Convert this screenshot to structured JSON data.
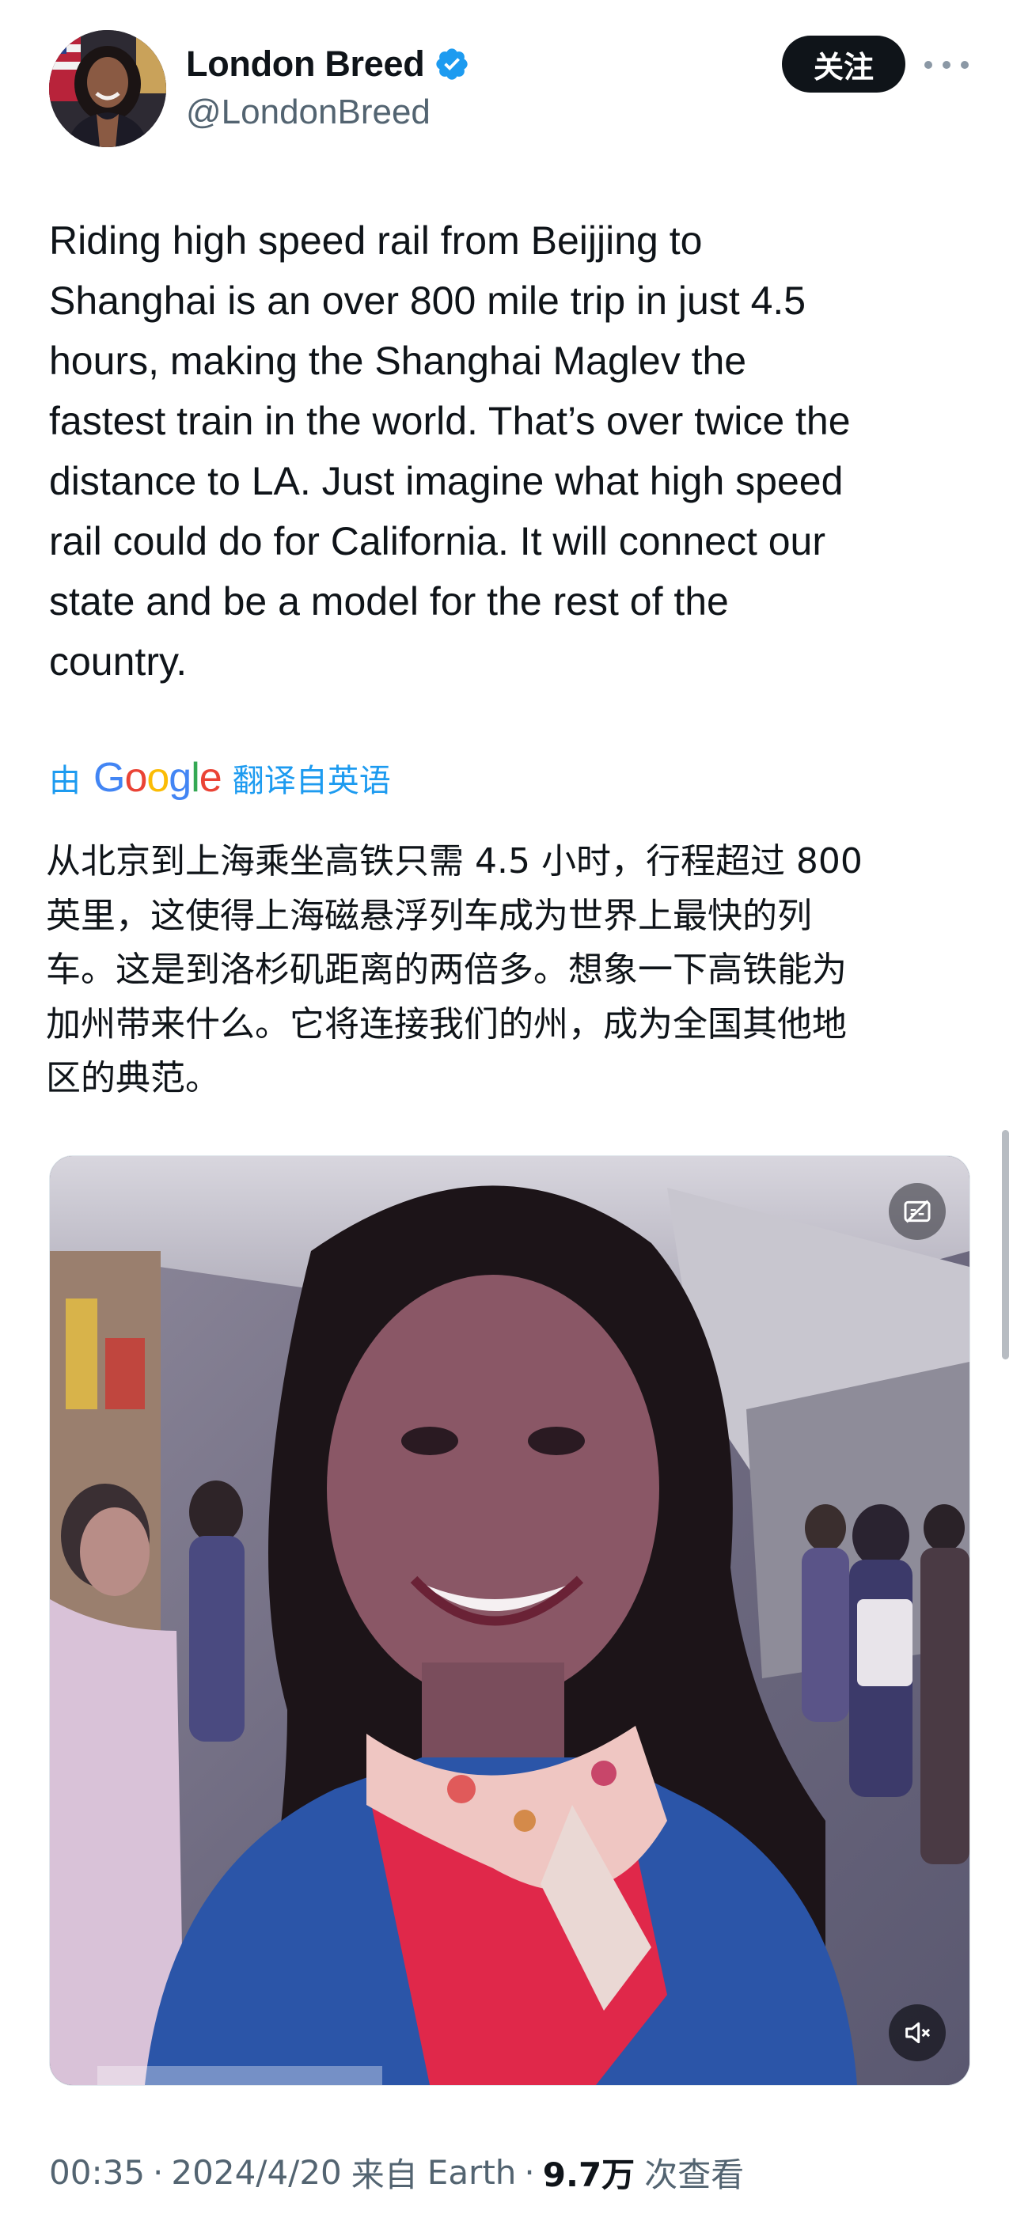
{
  "author": {
    "display_name": "London Breed",
    "handle": "@LondonBreed",
    "verified": true
  },
  "actions": {
    "follow_label": "关注"
  },
  "tweet": {
    "text": "Riding high speed rail from Beijjing to\nShanghai is an over 800 mile trip in just 4.5\nhours, making the Shanghai Maglev the\nfastest train in the world. That’s over twice the\ndistance to LA. Just imagine what high speed\nrail could do for California. It will connect our\nstate and be a model for the rest of the\ncountry."
  },
  "translation": {
    "prefix": "由",
    "provider": "Google",
    "suffix": "翻译自英语",
    "text": "从北京到上海乘坐高铁只需 4.5 小时，行程超过 800\n英里，这使得上海磁悬浮列车成为世界上最快的列\n车。这是到洛杉矶距离的两倍多。想象一下高铁能为\n加州带来什么。它将连接我们的州，成为全国其他地\n区的典范。"
  },
  "media": {
    "type": "video",
    "muted": true
  },
  "meta": {
    "time": "00:35",
    "date": "2024/4/20",
    "source_prefix": "来自",
    "source": "Earth",
    "views_count": "9.7万",
    "views_label": "次查看"
  },
  "colors": {
    "accent": "#1d9bf0",
    "text_primary": "#0f1419",
    "text_secondary": "#536471",
    "follow_bg": "#0f1419"
  },
  "icons": {
    "verified": "verified-badge-icon",
    "more": "more-horizontal-icon",
    "captions": "captions-off-icon",
    "mute": "volume-muted-icon"
  }
}
